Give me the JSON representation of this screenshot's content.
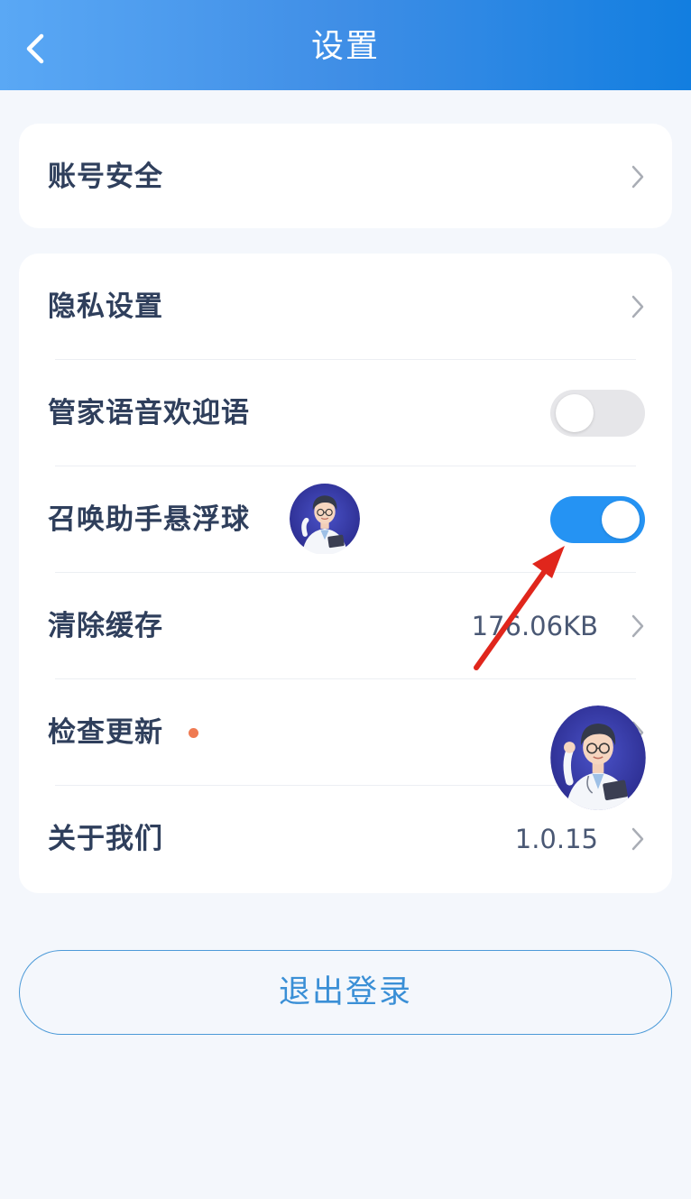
{
  "header": {
    "title": "设置",
    "back_icon": "chevron-left-icon"
  },
  "account_card": {
    "items": [
      {
        "label": "账号安全",
        "type": "link"
      }
    ]
  },
  "settings_card": {
    "items": [
      {
        "label": "隐私设置",
        "type": "link"
      },
      {
        "label": "管家语音欢迎语",
        "type": "toggle",
        "enabled": false
      },
      {
        "label": "召唤助手悬浮球",
        "type": "toggle",
        "enabled": true
      },
      {
        "label": "清除缓存",
        "type": "link",
        "value": "176.06KB"
      },
      {
        "label": "检查更新",
        "type": "link",
        "has_badge": true
      },
      {
        "label": "关于我们",
        "type": "link",
        "value": "1.0.15"
      }
    ]
  },
  "logout": {
    "label": "退出登录"
  },
  "colors": {
    "header_gradient_start": "#5aa8f5",
    "header_gradient_end": "#127ee0",
    "toggle_on": "#2593f3",
    "toggle_off": "#e6e6e9",
    "badge": "#ef7a52",
    "logout_accent": "#3a8fd6",
    "annotation_arrow": "#e0261c"
  }
}
